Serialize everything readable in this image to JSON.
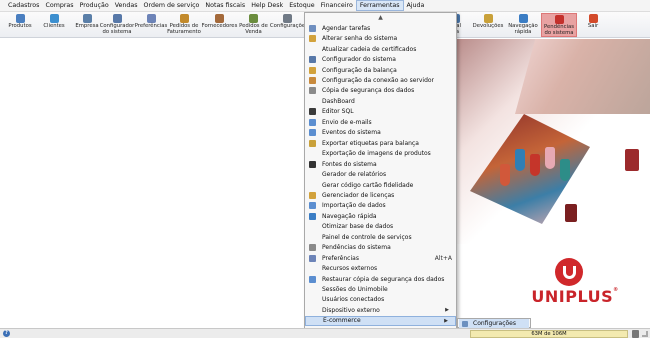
{
  "menubar": {
    "items": [
      "Cadastros",
      "Compras",
      "Produção",
      "Vendas",
      "Ordem de serviço",
      "Notas fiscais",
      "Help Desk",
      "Estoque",
      "Financeiro",
      "Ferramentas",
      "Ajuda"
    ],
    "active_index": 9
  },
  "toolbar": {
    "buttons": [
      {
        "label": "Produtos",
        "icon": "products-icon",
        "color": "#4a7fc0"
      },
      {
        "label": "Clientes",
        "icon": "clients-icon",
        "color": "#3c8fcf"
      },
      {
        "label": "Empresa",
        "icon": "company-icon",
        "color": "#5a7fa8"
      },
      {
        "label": "Configurador\ndo sistema",
        "icon": "system-config-icon",
        "color": "#5778a8"
      },
      {
        "label": "Preferências",
        "icon": "preferences-icon",
        "color": "#6d84b8"
      },
      {
        "label": "Pedidos de\nFaturamento",
        "icon": "orders-icon",
        "color": "#c28a2c"
      },
      {
        "label": "Fornecedores",
        "icon": "suppliers-icon",
        "color": "#a46a3b"
      },
      {
        "label": "Pedidos de\nVenda",
        "icon": "sales-orders-icon",
        "color": "#6b8d3e"
      },
      {
        "label": "Configuraçõe",
        "icon": "settings-icon",
        "color": "#707a86"
      },
      {
        "label": "iscal\nída",
        "icon": "invoice-icon",
        "color": "#4e7db3"
      },
      {
        "label": "Devoluções",
        "icon": "returns-icon",
        "color": "#c9a13a"
      },
      {
        "label": "Navegação\nrápida",
        "icon": "quick-nav-icon",
        "color": "#3b7dc4"
      },
      {
        "label": "Pendências\ndo sistema",
        "icon": "pending-icon",
        "color": "#c4302b"
      },
      {
        "label": "Sair",
        "icon": "exit-icon",
        "color": "#d34a2a"
      }
    ]
  },
  "tools_menu": {
    "scroll_up": "▲",
    "items": [
      {
        "label": "Agendar tarefas",
        "icon": "schedule-icon",
        "color": "#6f8fbf",
        "shortcut": "",
        "submenu": false
      },
      {
        "label": "Alterar senha do sistema",
        "icon": "password-icon",
        "color": "#d2a23c",
        "shortcut": "",
        "submenu": false
      },
      {
        "label": "Atualizar cadeia de certificados",
        "icon": "",
        "color": "",
        "shortcut": "",
        "submenu": false
      },
      {
        "label": "Configurador do sistema",
        "icon": "system-config-icon",
        "color": "#5778a8",
        "shortcut": "",
        "submenu": false
      },
      {
        "label": "Configuração da balança",
        "icon": "scale-icon",
        "color": "#d2a23c",
        "shortcut": "",
        "submenu": false
      },
      {
        "label": "Configuração da conexão ao servidor",
        "icon": "server-icon",
        "color": "#c88a3c",
        "shortcut": "",
        "submenu": false
      },
      {
        "label": "Cópia de segurança dos dados",
        "icon": "backup-icon",
        "color": "#8a8a8a",
        "shortcut": "",
        "submenu": false
      },
      {
        "label": "DashBoard",
        "icon": "",
        "color": "",
        "shortcut": "",
        "submenu": false
      },
      {
        "label": "Editor SQL",
        "icon": "sql-editor-icon",
        "color": "#3a3a3a",
        "shortcut": "",
        "submenu": false
      },
      {
        "label": "Envio de e-mails",
        "icon": "email-icon",
        "color": "#5b8ed0",
        "shortcut": "",
        "submenu": false
      },
      {
        "label": "Eventos do sistema",
        "icon": "events-icon",
        "color": "#5b8ed0",
        "shortcut": "",
        "submenu": false
      },
      {
        "label": "Exportar etiquetas para balança",
        "icon": "export-labels-icon",
        "color": "#c9a13a",
        "shortcut": "",
        "submenu": false
      },
      {
        "label": "Exportação de imagens de produtos",
        "icon": "",
        "color": "",
        "shortcut": "",
        "submenu": false
      },
      {
        "label": "Fontes do sistema",
        "icon": "fonts-icon",
        "color": "#333333",
        "shortcut": "",
        "submenu": false
      },
      {
        "label": "Gerador de relatórios",
        "icon": "",
        "color": "",
        "shortcut": "",
        "submenu": false
      },
      {
        "label": "Gerar código cartão fidelidade",
        "icon": "",
        "color": "",
        "shortcut": "",
        "submenu": false
      },
      {
        "label": "Gerenciador de licenças",
        "icon": "license-icon",
        "color": "#d2a23c",
        "shortcut": "",
        "submenu": false
      },
      {
        "label": "Importação de dados",
        "icon": "import-icon",
        "color": "#5b8ed0",
        "shortcut": "",
        "submenu": false
      },
      {
        "label": "Navegação rápida",
        "icon": "quick-nav-icon",
        "color": "#3b7dc4",
        "shortcut": "",
        "submenu": false
      },
      {
        "label": "Otimizar base de dados",
        "icon": "",
        "color": "",
        "shortcut": "",
        "submenu": false
      },
      {
        "label": "Painel de controle de serviços",
        "icon": "",
        "color": "",
        "shortcut": "",
        "submenu": false
      },
      {
        "label": "Pendências do sistema",
        "icon": "pending-icon",
        "color": "#8a8a8a",
        "shortcut": "",
        "submenu": false
      },
      {
        "label": "Preferências",
        "icon": "preferences-icon",
        "color": "#6d84b8",
        "shortcut": "Alt+A",
        "submenu": false
      },
      {
        "label": "Recursos externos",
        "icon": "",
        "color": "",
        "shortcut": "",
        "submenu": false
      },
      {
        "label": "Restaurar cópia de segurança dos dados",
        "icon": "restore-icon",
        "color": "#5b8ed0",
        "shortcut": "",
        "submenu": false
      },
      {
        "label": "Sessões do Unimobile",
        "icon": "",
        "color": "",
        "shortcut": "",
        "submenu": false
      },
      {
        "label": "Usuários conectados",
        "icon": "",
        "color": "",
        "shortcut": "",
        "submenu": false
      },
      {
        "label": "Dispositivo externo",
        "icon": "",
        "color": "",
        "shortcut": "",
        "submenu": true
      },
      {
        "label": "E-commerce",
        "icon": "",
        "color": "",
        "shortcut": "",
        "submenu": true
      },
      {
        "label": "Fiscal",
        "icon": "",
        "color": "",
        "shortcut": "",
        "submenu": true
      }
    ],
    "selected_index": 28
  },
  "ecommerce_submenu": {
    "label": "Configurações",
    "icon": "settings-icon"
  },
  "brand": {
    "name": "UNIPLUS",
    "registered": "®",
    "color": "#c9242a"
  },
  "statusbar": {
    "help": "?",
    "memory": "63M de 106M"
  }
}
